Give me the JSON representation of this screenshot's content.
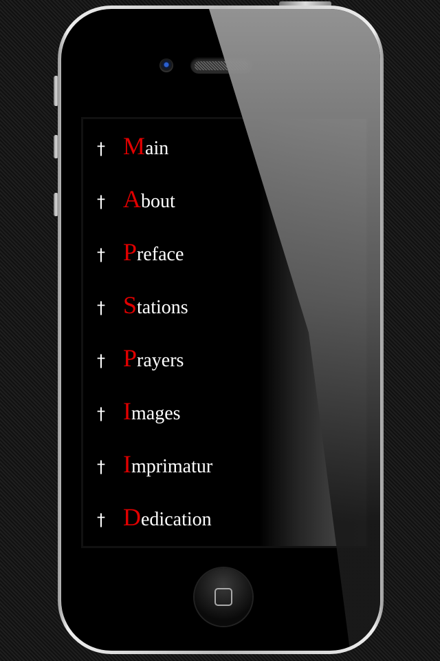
{
  "menu": {
    "items": [
      {
        "initial": "M",
        "rest": "ain",
        "icon": "cross-icon"
      },
      {
        "initial": "A",
        "rest": "bout",
        "icon": "cross-icon"
      },
      {
        "initial": "P",
        "rest": "reface",
        "icon": "cross-icon"
      },
      {
        "initial": "S",
        "rest": "tations",
        "icon": "cross-icon"
      },
      {
        "initial": "P",
        "rest": "rayers",
        "icon": "cross-icon"
      },
      {
        "initial": "I",
        "rest": "mages",
        "icon": "cross-icon"
      },
      {
        "initial": "I",
        "rest": "mprimatur",
        "icon": "cross-icon"
      },
      {
        "initial": "D",
        "rest": "edication",
        "icon": "cross-icon"
      }
    ],
    "cross_glyph": "†"
  },
  "colors": {
    "accent": "#e00000",
    "text": "#ffffff",
    "background": "#000000"
  }
}
